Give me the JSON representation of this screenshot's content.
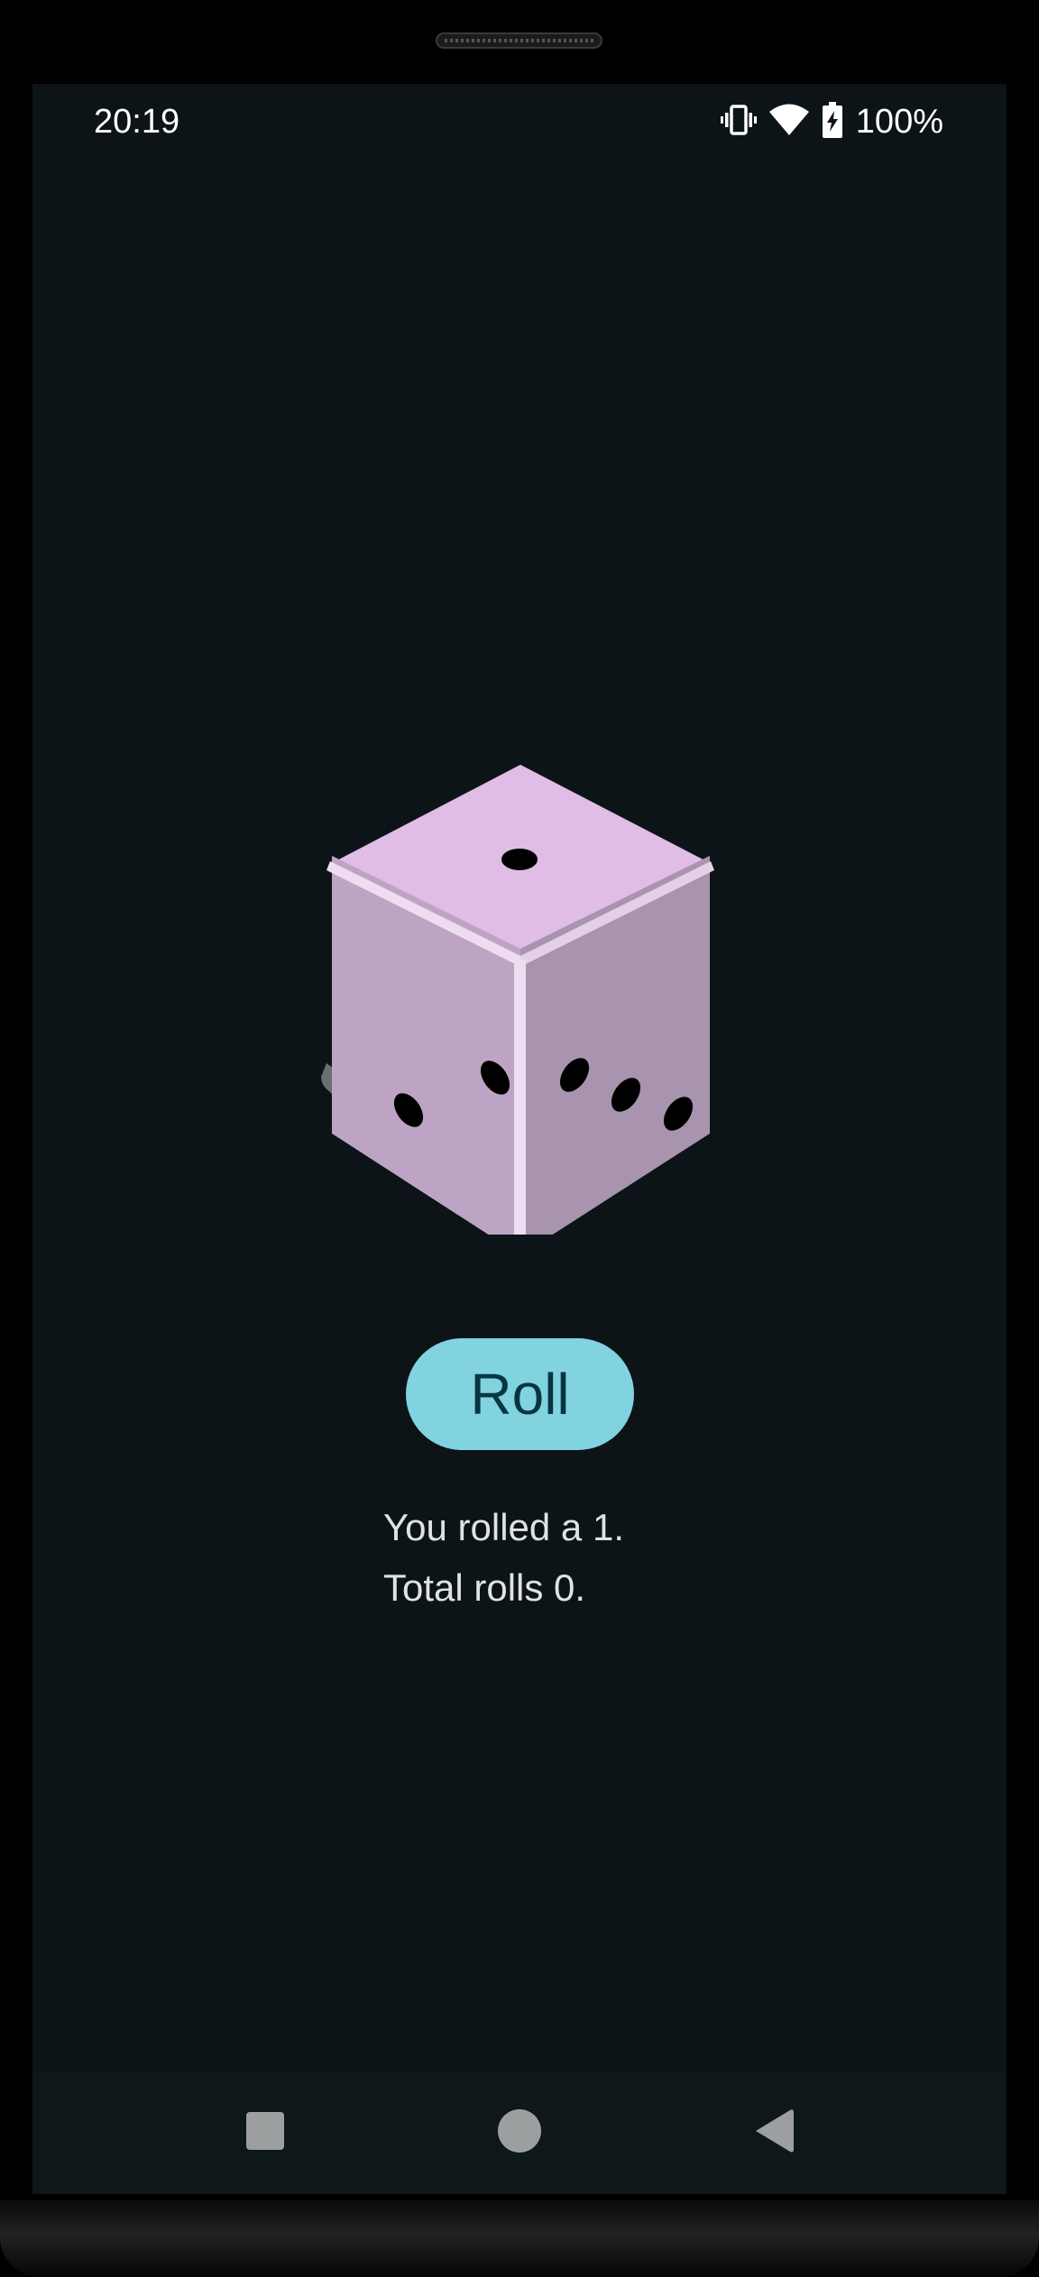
{
  "status_bar": {
    "time": "20:19",
    "battery": "100%",
    "icons": [
      "vibrate-icon",
      "wifi-icon",
      "battery-charging-icon"
    ]
  },
  "dice": {
    "value": 1,
    "colors": {
      "top": "#dfbde5",
      "left": "#bea4c4",
      "right": "#a894ae",
      "edge": "#eedcf0",
      "shadow": "#6b6f70",
      "pip": "#000000"
    }
  },
  "roll_button": {
    "label": "Roll",
    "color": "#81d3df"
  },
  "result": {
    "rolled": "You rolled a 1.",
    "total": "Total rolls 0."
  },
  "nav_bar": {
    "icons": [
      "recents-icon",
      "home-icon",
      "back-icon"
    ]
  }
}
